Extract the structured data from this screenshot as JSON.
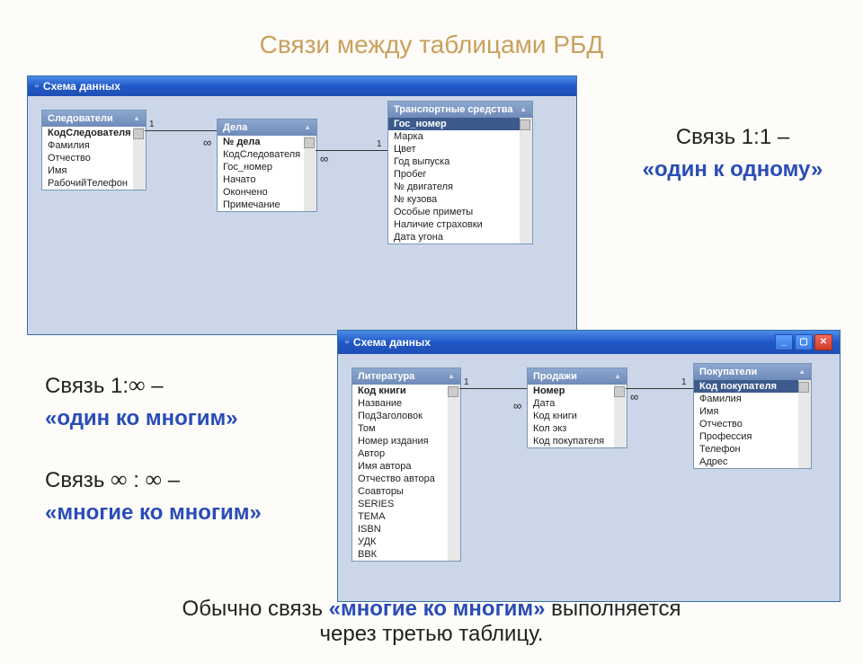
{
  "page": {
    "title": "Связи между таблицами РБД",
    "anno1a": "Связь 1:1 –",
    "anno1b": "«один к одному»",
    "anno2a": "Связь 1:",
    "anno2b": " –",
    "anno2c": "«один ко многим»",
    "anno3a": "Связь ",
    "anno3b": " : ",
    "anno3c": " –",
    "anno3d": "«многие ко многим»",
    "footer1a": "Обычно связь ",
    "footer1b": "«многие ко многим»",
    "footer1c": " выполняется",
    "footer2": "через третью таблицу."
  },
  "win1": {
    "title": "Схема данных",
    "tables": {
      "t1": {
        "title": "Следователи",
        "rows": [
          "КодСледователя",
          "Фамилия",
          "Отчество",
          "Имя",
          "РабочийТелефон"
        ],
        "key": 0
      },
      "t2": {
        "title": "Дела",
        "rows": [
          "№ дела",
          "КодСледователя",
          "Гос_номер",
          "Начато",
          "Окончено",
          "Примечание"
        ],
        "key": 0
      },
      "t3": {
        "title": "Транспортные средства",
        "rows": [
          "Гос_номер",
          "Марка",
          "Цвет",
          "Год выпуска",
          "Пробег",
          "№ двигателя",
          "№ кузова",
          "Особые приметы",
          "Наличие страховки",
          "Дата угона"
        ],
        "hl": 0
      }
    },
    "rel": {
      "l1a": "1",
      "l1b": "∞",
      "l2a": "∞",
      "l2b": "1"
    }
  },
  "win2": {
    "title": "Схема данных",
    "tables": {
      "t1": {
        "title": "Литература",
        "rows": [
          "Код книги",
          "Название",
          "ПодЗаголовок",
          "Том",
          "Номер издания",
          "Автор",
          "Имя автора",
          "Отчество автора",
          "Соавторы",
          "SERIES",
          "ТЕМА",
          "ISBN",
          "УДК",
          "ВВК"
        ],
        "key": 0
      },
      "t2": {
        "title": "Продажи",
        "rows": [
          "Номер",
          "Дата",
          "Код книги",
          "Кол экз",
          "Код покупателя"
        ],
        "key": 0
      },
      "t3": {
        "title": "Покупатели",
        "rows": [
          "Код покупателя",
          "Фамилия",
          "Имя",
          "Отчество",
          "Профессия",
          "Телефон",
          "Адрес"
        ],
        "hl": 0
      }
    },
    "rel": {
      "l1a": "1",
      "l1b": "∞",
      "l2a": "∞",
      "l2b": "1"
    }
  }
}
